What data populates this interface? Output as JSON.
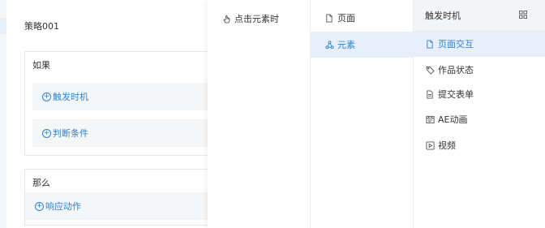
{
  "policy": {
    "title": "策略001",
    "if_label": "如果",
    "trigger_label": "触发时机",
    "condition_label": "判断条件",
    "then_label": "那么",
    "action_label": "响应动作"
  },
  "menu": {
    "col1": [
      {
        "label": "点击元素时"
      }
    ],
    "col2": [
      {
        "label": "页面"
      },
      {
        "label": "元素"
      }
    ],
    "col3_header": "触发时机",
    "col3": [
      {
        "label": "页面交互"
      },
      {
        "label": "作品状态"
      },
      {
        "label": "提交表单"
      },
      {
        "label": "AE动画"
      },
      {
        "label": "视频"
      }
    ]
  },
  "colors": {
    "accent": "#2c83d3",
    "active_bg": "#e6effa"
  }
}
